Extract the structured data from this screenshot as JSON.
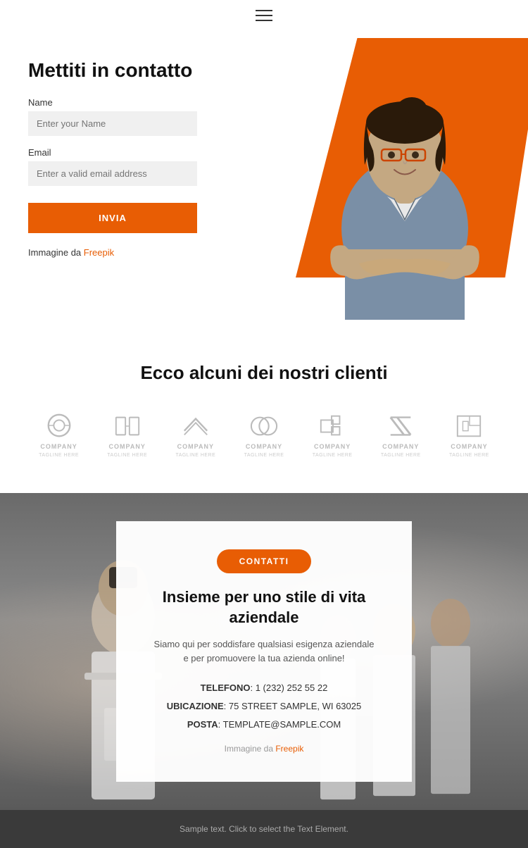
{
  "header": {
    "menu_icon": "hamburger"
  },
  "hero": {
    "title": "Mettiti in contatto",
    "name_label": "Name",
    "name_placeholder": "Enter your Name",
    "email_label": "Email",
    "email_placeholder": "Enter a valid email address",
    "submit_button": "INVIA",
    "image_credit_text": "Immagine da",
    "image_credit_link": "Freepik"
  },
  "clients": {
    "title": "Ecco alcuni dei nostri clienti",
    "logos": [
      {
        "id": 1,
        "name": "COMPANY",
        "sub": "TAGLINE HERE"
      },
      {
        "id": 2,
        "name": "COMPANY",
        "sub": "TAGLINE HERE"
      },
      {
        "id": 3,
        "name": "COMPANY",
        "sub": "TAGLINE HERE"
      },
      {
        "id": 4,
        "name": "COMPANY",
        "sub": "TAGLINE HERE"
      },
      {
        "id": 5,
        "name": "COMPANY",
        "sub": "TAGLINE HERE"
      },
      {
        "id": 6,
        "name": "COMPANY",
        "sub": "TAGLINE HERE"
      },
      {
        "id": 7,
        "name": "COMPANY",
        "sub": "TAGLINE HERE"
      }
    ]
  },
  "cta": {
    "button_label": "CONTATTI",
    "title": "Insieme per uno stile di vita aziendale",
    "description": "Siamo qui per soddisfare qualsiasi esigenza aziendale e per promuovere la tua azienda online!",
    "phone_label": "TELEFONO",
    "phone_value": "1 (232) 252 55 22",
    "location_label": "UBICAZIONE",
    "location_value": "75 STREET SAMPLE, WI 63025",
    "email_label": "POSTA",
    "email_value": "TEMPLATE@SAMPLE.COM",
    "image_credit_text": "Immagine da",
    "image_credit_link": "Freepik"
  },
  "footer": {
    "text": "Sample text. Click to select the Text Element."
  },
  "colors": {
    "orange": "#e85d04",
    "dark": "#3a3a3a"
  }
}
